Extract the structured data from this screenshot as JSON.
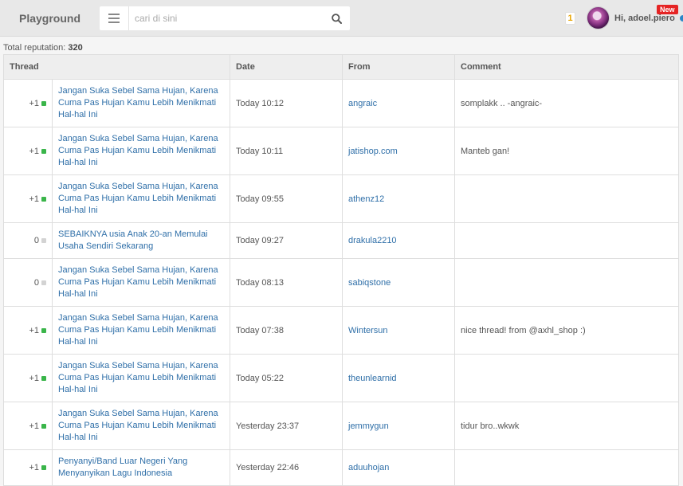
{
  "header": {
    "brand": "Playground",
    "search_placeholder": "cari di sini",
    "notification_count": "1",
    "greeting": "Hi, adoel.piero",
    "new_badge": "New"
  },
  "summary": {
    "label": "Total reputation: ",
    "value": "320"
  },
  "table": {
    "columns": [
      "Thread",
      "Date",
      "From",
      "Comment"
    ],
    "rows": [
      {
        "rep": "+1",
        "status": "positive",
        "thread": "Jangan Suka Sebel Sama Hujan, Karena Cuma Pas Hujan Kamu Lebih Menikmati Hal-hal Ini",
        "date": "Today 10:12",
        "from": "angraic",
        "comment": "somplakk .. -angraic-"
      },
      {
        "rep": "+1",
        "status": "positive",
        "thread": "Jangan Suka Sebel Sama Hujan, Karena Cuma Pas Hujan Kamu Lebih Menikmati Hal-hal Ini",
        "date": "Today 10:11",
        "from": "jatishop.com",
        "comment": "Manteb gan!"
      },
      {
        "rep": "+1",
        "status": "positive",
        "thread": "Jangan Suka Sebel Sama Hujan, Karena Cuma Pas Hujan Kamu Lebih Menikmati Hal-hal Ini",
        "date": "Today 09:55",
        "from": "athenz12",
        "comment": ""
      },
      {
        "rep": "0",
        "status": "neutral",
        "thread": "SEBAIKNYA usia Anak 20-an Memulai Usaha Sendiri Sekarang",
        "date": "Today 09:27",
        "from": "drakula2210",
        "comment": ""
      },
      {
        "rep": "0",
        "status": "neutral",
        "thread": "Jangan Suka Sebel Sama Hujan, Karena Cuma Pas Hujan Kamu Lebih Menikmati Hal-hal Ini",
        "date": "Today 08:13",
        "from": "sabiqstone",
        "comment": ""
      },
      {
        "rep": "+1",
        "status": "positive",
        "thread": "Jangan Suka Sebel Sama Hujan, Karena Cuma Pas Hujan Kamu Lebih Menikmati Hal-hal Ini",
        "date": "Today 07:38",
        "from": "Wintersun",
        "comment": "nice thread! from @axhl_shop :)"
      },
      {
        "rep": "+1",
        "status": "positive",
        "thread": "Jangan Suka Sebel Sama Hujan, Karena Cuma Pas Hujan Kamu Lebih Menikmati Hal-hal Ini",
        "date": "Today 05:22",
        "from": "theunlearnid",
        "comment": ""
      },
      {
        "rep": "+1",
        "status": "positive",
        "thread": "Jangan Suka Sebel Sama Hujan, Karena Cuma Pas Hujan Kamu Lebih Menikmati Hal-hal Ini",
        "date": "Yesterday 23:37",
        "from": "jemmygun",
        "comment": "tidur bro..wkwk"
      },
      {
        "rep": "+1",
        "status": "positive",
        "thread": "Penyanyi/Band Luar Negeri Yang Menyanyikan Lagu Indonesia",
        "date": "Yesterday 22:46",
        "from": "aduuhojan",
        "comment": ""
      }
    ]
  },
  "icons": {
    "menu": "hamburger-menu-icon",
    "search": "search-icon",
    "status_positive": "green-square-dot",
    "status_neutral": "grey-square-dot"
  },
  "colors": {
    "link": "#2f6fa8",
    "positive": "#3ab54a",
    "neutral": "#d3d3d3",
    "new_badge": "#e52424",
    "notification": "#e8a400"
  }
}
